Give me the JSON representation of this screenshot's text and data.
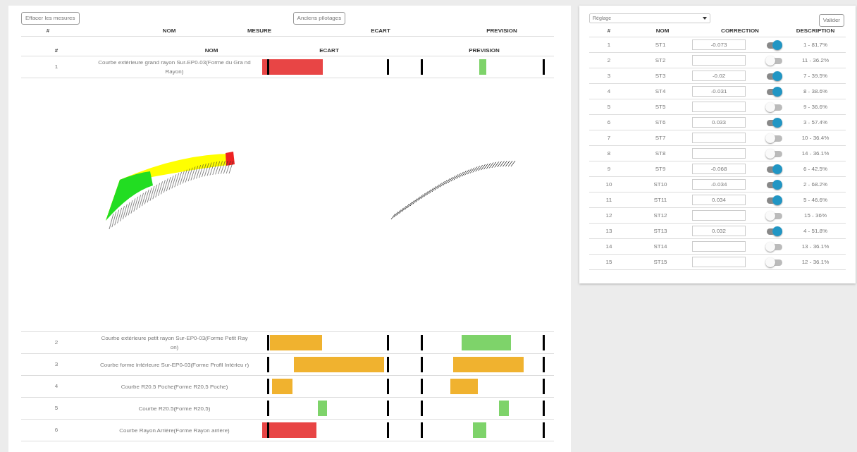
{
  "left_panel": {
    "clear_button": "Effacer les mesures",
    "history_button": "Anciens pilotages",
    "header_1": [
      "#",
      "NOM",
      "MESURE",
      "ECART",
      "PREVISION"
    ],
    "header_2": [
      "#",
      "NOM",
      "ECART",
      "PREVISION"
    ],
    "rows": [
      {
        "index": "1",
        "name": "Courbe extérieure grand rayon Sur-EP0-03(Forme du Gra nd Rayon)",
        "ecart": {
          "color": "#e84545"
        },
        "prevision": {
          "color": "#7ed36a"
        }
      },
      {
        "index": "2",
        "name": "Courbe extérieure petit rayon Sur-EP0-03(Forme Petit Ray on)",
        "ecart": {
          "color": "#f0b22f"
        },
        "prevision": {
          "color": "#7ed36a"
        }
      },
      {
        "index": "3",
        "name": "Courbe forme intérieure Sur-EP0-03(Forme Profil Intérieu r)",
        "ecart": {
          "color": "#f0b22f"
        },
        "prevision": {
          "color": "#f0b22f"
        }
      },
      {
        "index": "4",
        "name": "Courbe R20.5 Poche(Forme R20,5 Poche)",
        "ecart": {
          "color": "#f0b22f"
        },
        "prevision": {
          "color": "#f0b22f"
        }
      },
      {
        "index": "5",
        "name": "Courbe R20.5(Forme R20,5)",
        "ecart": {
          "color": "#7ed36a"
        },
        "prevision": {
          "color": "#7ed36a"
        }
      },
      {
        "index": "6",
        "name": "Courbe Rayon Arrière(Forme Rayon arrière)",
        "ecart": {
          "color": "#e84545"
        },
        "prevision": {
          "color": "#7ed36a"
        }
      }
    ]
  },
  "right_panel": {
    "select": "Réglage",
    "submit_button": "Valider",
    "columns": [
      "#",
      "NOM",
      "CORRECTION",
      "DESCRIPTION"
    ],
    "rows": [
      {
        "index": "1",
        "name": "ST1",
        "correction": "-0.073",
        "on": true,
        "description": "1 - 81.7%"
      },
      {
        "index": "2",
        "name": "ST2",
        "on": false,
        "description": "11 - 36.2%"
      },
      {
        "index": "3",
        "name": "ST3",
        "correction": "-0.02",
        "on": true,
        "description": "7 - 39.5%"
      },
      {
        "index": "4",
        "name": "ST4",
        "correction": "-0.031",
        "on": true,
        "description": "8 - 38.6%"
      },
      {
        "index": "5",
        "name": "ST5",
        "on": false,
        "description": "9 - 36.6%"
      },
      {
        "index": "6",
        "name": "ST6",
        "correction": "0.033",
        "on": true,
        "description": "3 - 57.4%"
      },
      {
        "index": "7",
        "name": "ST7",
        "on": false,
        "description": "10 - 36.4%"
      },
      {
        "index": "8",
        "name": "ST8",
        "on": false,
        "description": "14 - 36.1%"
      },
      {
        "index": "9",
        "name": "ST9",
        "correction": "-0.068",
        "on": true,
        "description": "6 - 42.5%"
      },
      {
        "index": "10",
        "name": "ST10",
        "correction": "-0.034",
        "on": true,
        "description": "2 - 68.2%"
      },
      {
        "index": "11",
        "name": "ST11",
        "correction": "0.034",
        "on": true,
        "description": "5 - 46.6%"
      },
      {
        "index": "12",
        "name": "ST12",
        "on": false,
        "description": "15 - 36%"
      },
      {
        "index": "13",
        "name": "ST13",
        "correction": "0.032",
        "on": true,
        "description": "4 - 51.8%"
      },
      {
        "index": "14",
        "name": "ST14",
        "on": false,
        "description": "13 - 36.1%"
      },
      {
        "index": "15",
        "name": "ST15",
        "on": false,
        "description": "12 - 36.1%"
      }
    ]
  }
}
